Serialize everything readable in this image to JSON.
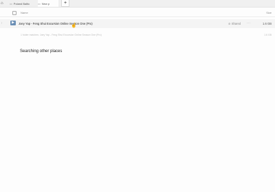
{
  "tabs": [
    {
      "label": "Poland Baltic",
      "icon": "folder-icon"
    },
    {
      "label": "New p",
      "icon": "folder-icon"
    }
  ],
  "add_tab_label": "+",
  "header": {
    "name": "Name",
    "size": "Size"
  },
  "file": {
    "name": "Joey Yap - Feng Shui Excursion Online Season One (Pro)",
    "shared": "Shared",
    "more": "···",
    "size": "1.6 GB"
  },
  "summary": {
    "text": "1 folder matches: Joey Yap - Feng Shui Excursion Online Season One (Pro)",
    "size": "1.6 GB"
  },
  "searching_label": "Searching other places"
}
